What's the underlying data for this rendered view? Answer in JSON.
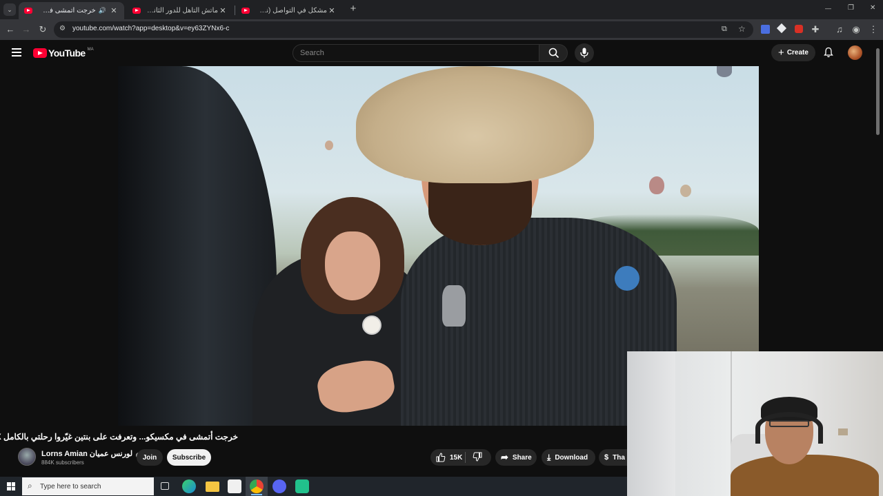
{
  "browser": {
    "tabs": [
      {
        "title": "خرجت أتمشى في مكسيكو...",
        "active": true
      },
      {
        "title": "ماتش التأهل للدور الثاني؟ (التشكـ",
        "active": false
      },
      {
        "title": "مشكل في التواصل (نظرية البراكـ",
        "active": false
      }
    ],
    "new_tab": "+",
    "url": "youtube.com/watch?app=desktop&v=ey63ZYNx6-c",
    "window_controls": {
      "minimize": "—",
      "restore": "❐",
      "close": "✕"
    }
  },
  "youtube": {
    "logo_text": "YouTube",
    "region": "MA",
    "search_placeholder": "Search",
    "create_label": "Create",
    "video": {
      "title": "خرجت أتمشى في مكسيكو... وتعرفت على بنتين غيّروا رحلتي بالكامل MX",
      "channel_name": "Lorns Amian لورنس عميان",
      "subscribers": "884K subscribers",
      "join_label": "Join",
      "subscribe_label": "Subscribe",
      "likes": "15K",
      "share_label": "Share",
      "download_label": "Download",
      "thanks_label": "Tha"
    }
  },
  "taskbar": {
    "search_placeholder": "Type here to search"
  },
  "colors": {
    "bg": "#0f0f0f",
    "brand_red": "#ff0033",
    "subscribe_bg": "#f1f1f1",
    "chrome_frame": "#202124",
    "chrome_toolbar": "#35363a"
  }
}
